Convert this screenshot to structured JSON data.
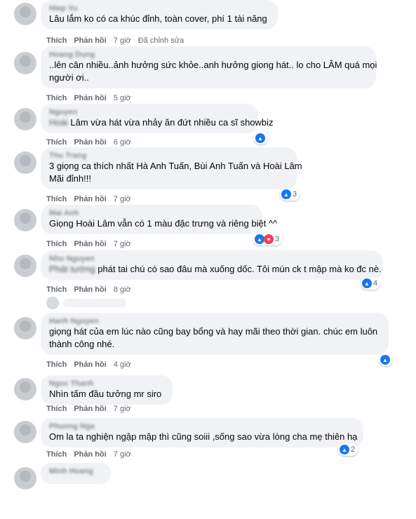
{
  "comments": [
    {
      "author": "Hiep Vu",
      "lines": [
        "Lâu lắm ko có ca khúc đỉnh, toàn cover, phí 1 tài năng"
      ],
      "like": "Thích",
      "reply": "Phản hồi",
      "time": "7 giờ",
      "edited": "Đã chỉnh sửa"
    },
    {
      "author": "Hoang Dung",
      "lines": [
        "..lên cân nhiều..ảnh hưởng sức khỏe..anh hưởng giong hát.. lo cho LÂM quá mọi",
        "người ơi.."
      ],
      "like": "Thích",
      "reply": "Phản hồi",
      "time": "5 giờ"
    },
    {
      "author": "Nguyen",
      "prefix": "Hoài",
      "lines": [
        "Lâm vừa hát vừa nhảy ăn đứt nhiều ca sĩ showbiz"
      ],
      "like": "Thích",
      "reply": "Phản hồi",
      "time": "6 giờ",
      "reactions": {
        "count": "",
        "types": [
          "like"
        ]
      }
    },
    {
      "author": "Thu Trang",
      "lines": [
        "3 giọng ca thích nhất Hà Anh Tuấn, Bùi Anh Tuấn và Hoài Lâm",
        "Mãi đỉnh!!!"
      ],
      "like": "Thích",
      "reply": "Phản hồi",
      "time": "7 giờ",
      "reactions": {
        "count": "3",
        "types": [
          "like"
        ]
      }
    },
    {
      "author": "Mai Anh",
      "lines": [
        "Giọng Hoài Lâm vẫn có 1 màu đặc trưng và riêng biệt ^^"
      ],
      "like": "Thích",
      "reply": "Phản hồi",
      "time": "7 giờ",
      "reactions": {
        "count": "3",
        "types": [
          "like",
          "heart"
        ]
      }
    },
    {
      "author": "Nhu Nguyen",
      "prefix": "Phát tướng",
      "lines": [
        "phát tai chú có sao đâu mà xuống dốc. Tôi mún ck t mập mà ko đc nè."
      ],
      "like": "Thích",
      "reply": "Phản hồi",
      "time": "8 giờ",
      "reactions": {
        "count": "4",
        "types": [
          "like"
        ]
      }
    },
    {
      "author": "Hanh Nguyen",
      "lines": [
        "giọng hát của em lúc nào cũng bay bổng và hay mãi theo thời gian. chúc em luôn",
        "thành công nhé."
      ],
      "like": "Thích",
      "reply": "Phản hồi",
      "time": "4 giờ",
      "reactions": {
        "count": "",
        "types": [
          "like"
        ]
      }
    },
    {
      "author": "Ngoc Thanh",
      "lines": [
        "Nhìn tấm đầu tưởng mr siro"
      ],
      "like": "Thích",
      "reply": "Phản hồi",
      "time": "7 giờ"
    },
    {
      "author": "Phuong Nga",
      "lines": [
        "Om la ta nghiện ngập mập thì cũng soiii ,sống sao vừa lòng cha mẹ thiên hạ"
      ],
      "like": "Thích",
      "reply": "Phản hồi",
      "time": "7 giờ",
      "reactions": {
        "count": "2",
        "types": [
          "like"
        ]
      }
    },
    {
      "author": "Minh Hoang",
      "lines": [],
      "like": "",
      "reply": "",
      "time": ""
    }
  ],
  "colors": {
    "bubble": "#f0f2f5",
    "like": "#1877f2",
    "heart": "#f33e58",
    "meta": "#65676b"
  },
  "icons": {
    "like": "like-reaction-icon",
    "heart": "heart-reaction-icon"
  }
}
